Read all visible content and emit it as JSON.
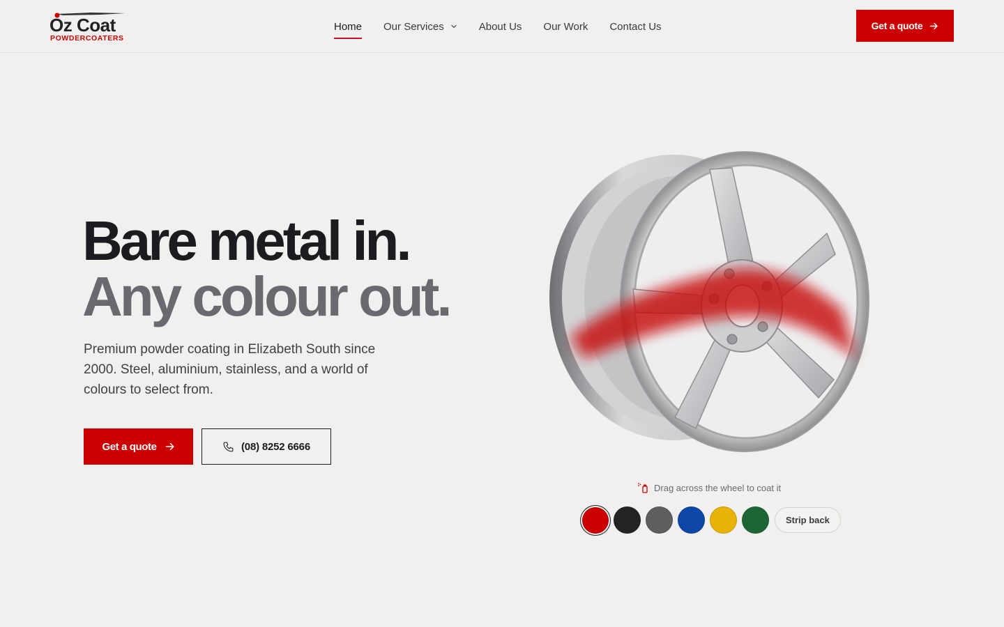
{
  "header": {
    "logo": {
      "text": "Oz Coat",
      "subtext": "POWDERCOATERS"
    },
    "nav": [
      {
        "label": "Home",
        "active": true
      },
      {
        "label": "Our Services",
        "has_dropdown": true
      },
      {
        "label": "About Us"
      },
      {
        "label": "Our Work"
      },
      {
        "label": "Contact Us"
      }
    ],
    "cta_label": "Get a quote"
  },
  "hero": {
    "title_line1": "Bare metal in.",
    "title_line2": "Any colour out.",
    "subtitle": "Premium powder coating in Elizabeth South since 2000. Steel, aluminium, stainless, and a world of colours to select from.",
    "primary_cta": "Get a quote",
    "phone": "(08) 8252 6666"
  },
  "wheel_demo": {
    "hint": "Drag across the wheel to coat it",
    "swatches": [
      {
        "name": "red",
        "color": "#cc0000",
        "selected": true
      },
      {
        "name": "black",
        "color": "#232326"
      },
      {
        "name": "grey",
        "color": "#5e5e60"
      },
      {
        "name": "blue",
        "color": "#0f47a8"
      },
      {
        "name": "yellow",
        "color": "#e8b208"
      },
      {
        "name": "green",
        "color": "#1c6636"
      }
    ],
    "strip_label": "Strip back"
  },
  "colors": {
    "brand_red": "#cc0000",
    "background": "#f1f0ee",
    "text_dark": "#1c1c20",
    "text_grey": "#6a696f"
  }
}
